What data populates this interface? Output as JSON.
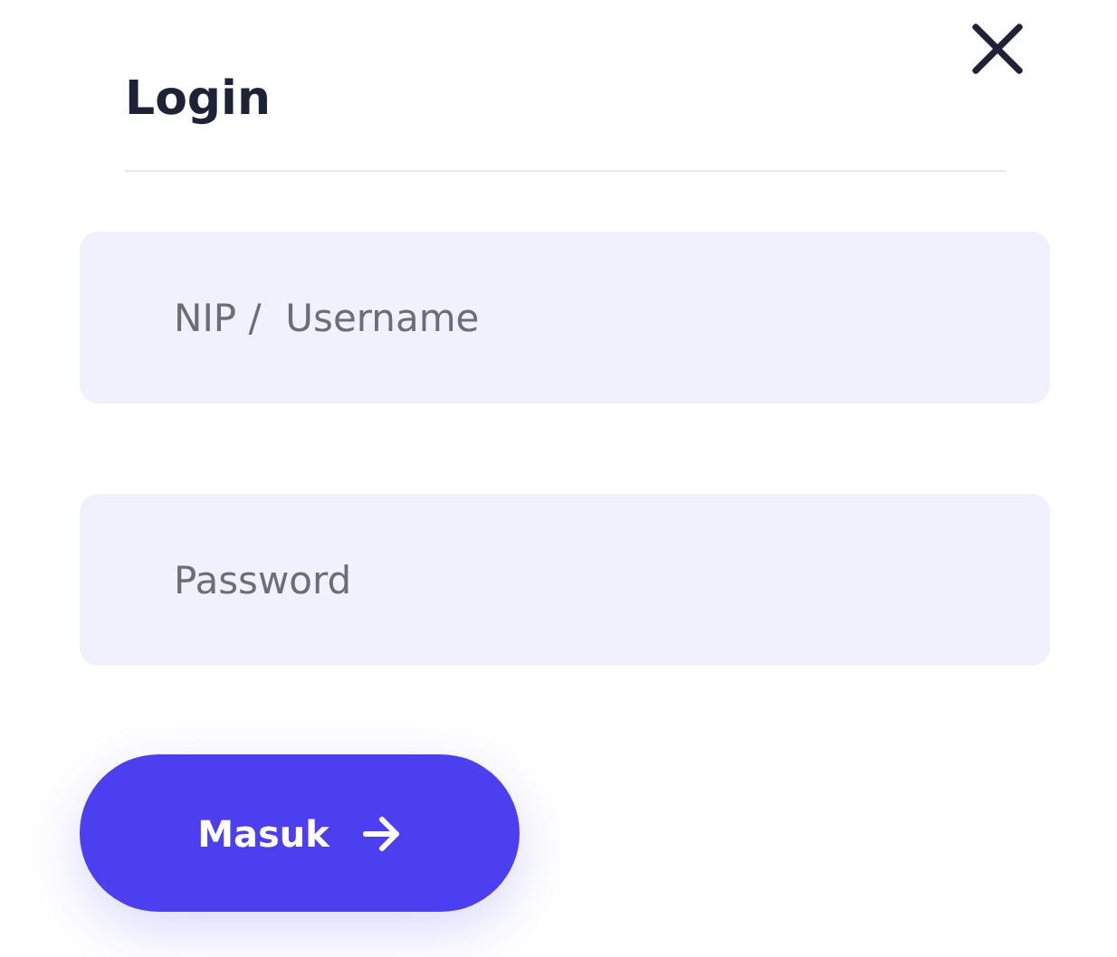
{
  "title": "Login",
  "fields": [
    {
      "placeholder": "NIP /  Username"
    },
    {
      "placeholder": "Password"
    }
  ],
  "button": {
    "label": "Masuk"
  }
}
